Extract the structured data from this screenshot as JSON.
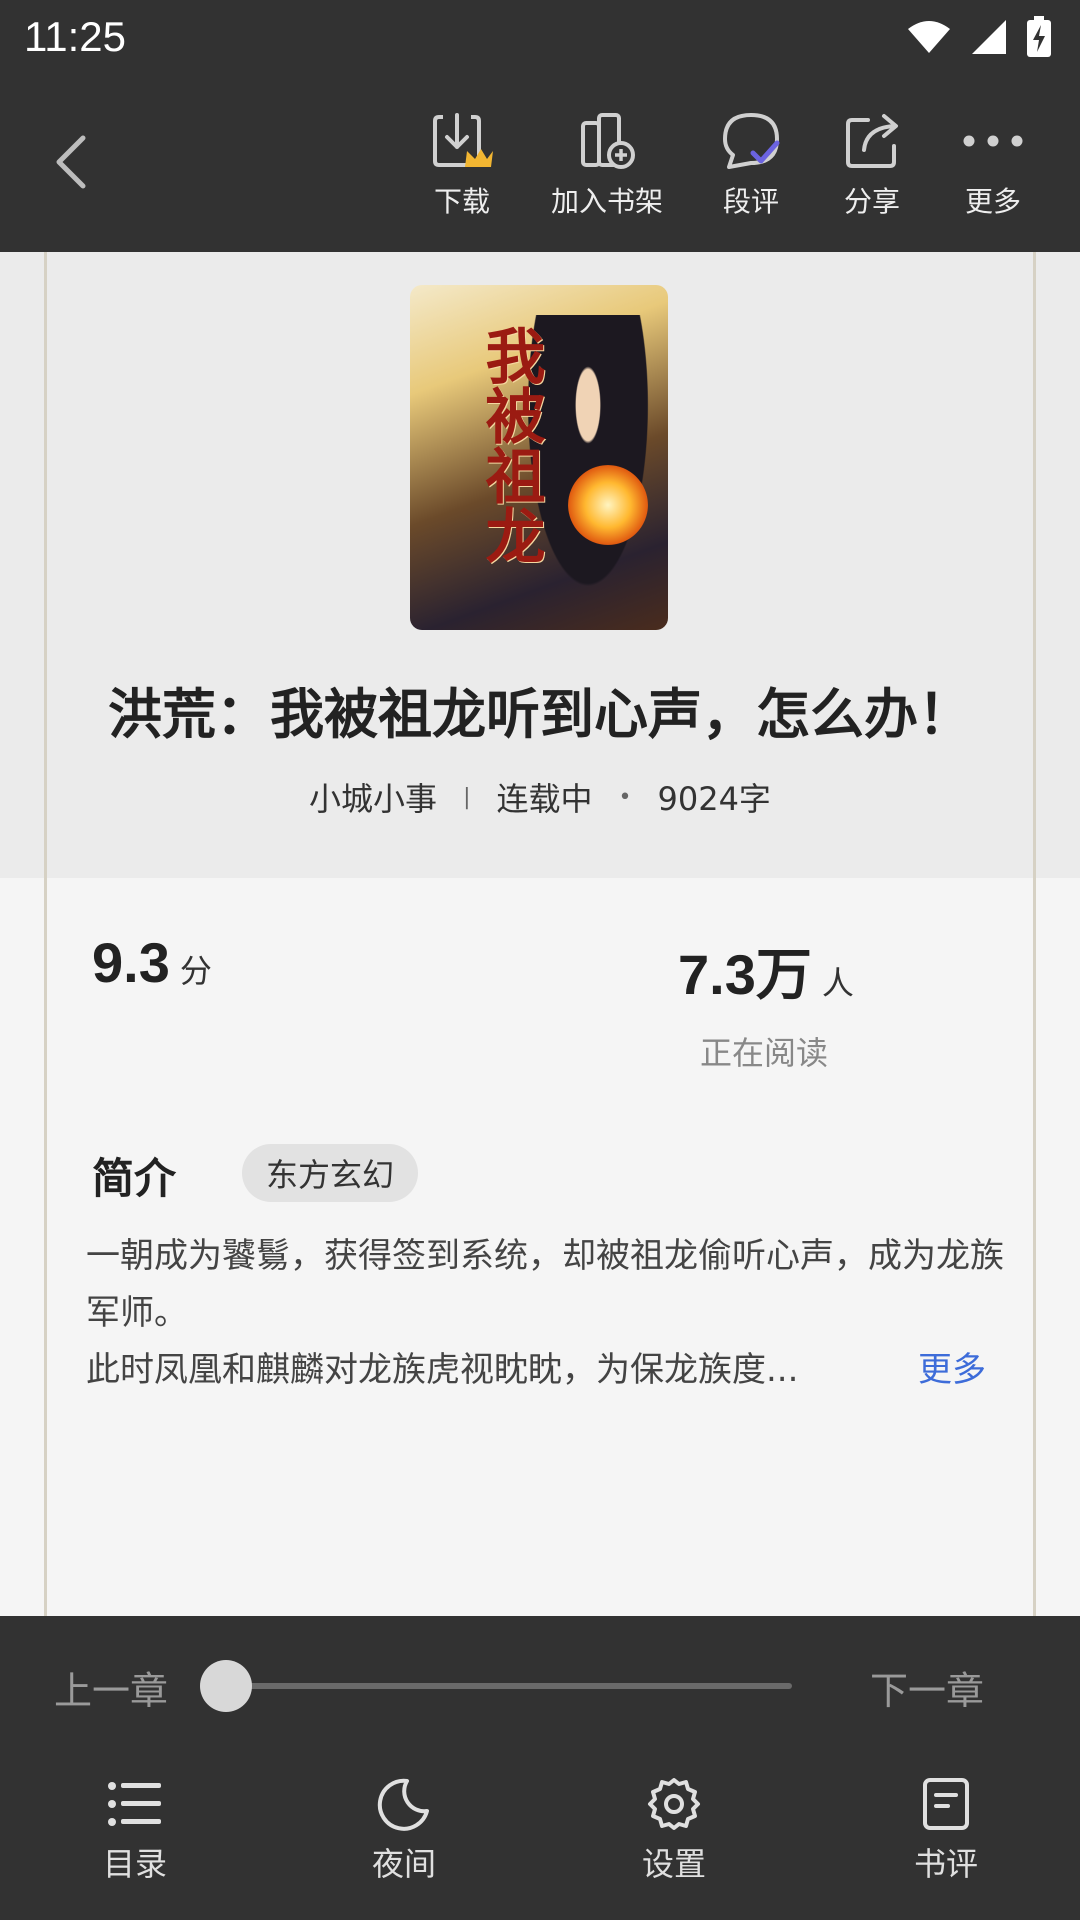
{
  "status_bar": {
    "time": "11:25"
  },
  "toolbar": {
    "download_label": "下载",
    "add_shelf_label": "加入书架",
    "comment_label": "段评",
    "share_label": "分享",
    "more_label": "更多"
  },
  "book": {
    "cover_title": "我被祖龙",
    "title": "洪荒：我被祖龙听到心声，怎么办！",
    "author": "小城小事",
    "status": "连载中",
    "word_count": "9024字"
  },
  "stats": {
    "score": "9.3",
    "score_unit": "分",
    "readers": "7.3万",
    "readers_unit": "人",
    "readers_label": "正在阅读"
  },
  "intro": {
    "heading": "简介",
    "tag": "东方玄幻",
    "text": "一朝成为饕鬄，获得签到系统，却被祖龙偷听心声，成为龙族军师。",
    "line3": "此时凤凰和麒麟对龙族虎视眈眈，为保龙族度...",
    "more_label": "更多"
  },
  "bottom": {
    "prev_chapter": "上一章",
    "next_chapter": "下一章",
    "progress": 0.0,
    "nav": {
      "toc_label": "目录",
      "night_label": "夜间",
      "settings_label": "设置",
      "review_label": "书评"
    }
  },
  "colors": {
    "bar_bg": "#323232",
    "link": "#3d6cd9",
    "comment_check": "#6b63e0",
    "crown": "#f2b632"
  }
}
